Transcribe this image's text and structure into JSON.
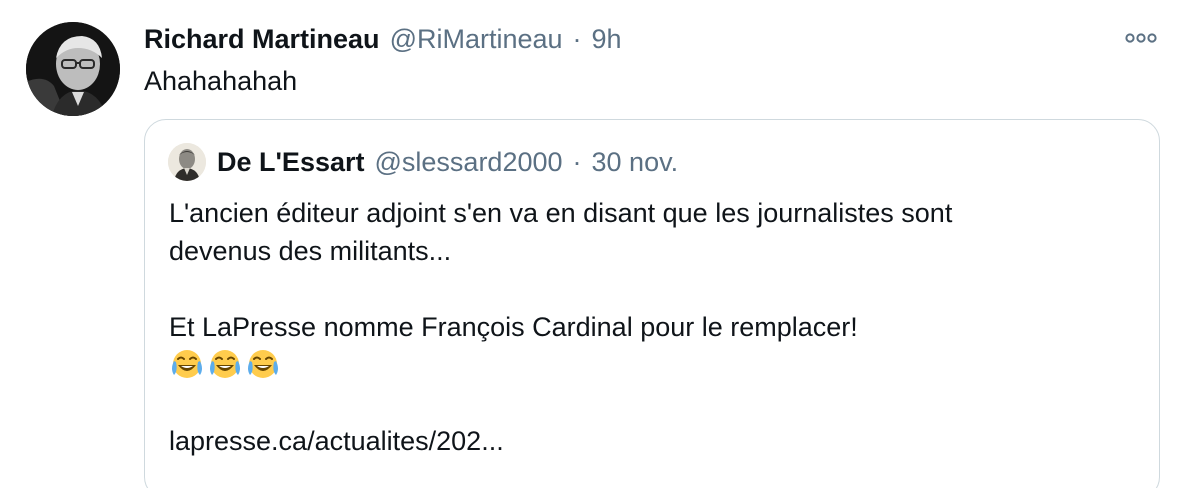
{
  "tweet": {
    "author": {
      "display_name": "Richard Martineau",
      "handle": "@RiMartineau",
      "separator": "·",
      "time": "9h"
    },
    "text": "Ahahahahah",
    "more_icon": "more-horizontal-icon"
  },
  "quote": {
    "author": {
      "display_name": "De L'Essart",
      "handle": "@slessard2000",
      "separator": "·",
      "time": "30 nov."
    },
    "lines": [
      "L'ancien éditeur adjoint s'en va en disant que les journalistes sont",
      "devenus des militants...",
      "Et LaPresse nomme François Cardinal pour le remplacer!"
    ],
    "emoji_icons": [
      "face-with-tears-of-joy-icon",
      "face-with-tears-of-joy-icon",
      "face-with-tears-of-joy-icon"
    ],
    "link": "lapresse.ca/actualites/202..."
  },
  "colors": {
    "text": "#0f1419",
    "secondary": "#5b7083",
    "border": "#cfd9de"
  }
}
